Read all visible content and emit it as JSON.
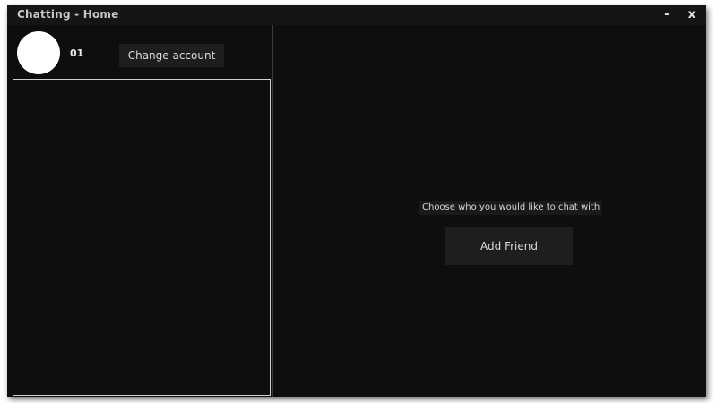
{
  "window": {
    "title": "Chatting - Home",
    "minimize_label": "-",
    "close_label": "x"
  },
  "sidebar": {
    "username": "01",
    "change_account_label": "Change account",
    "friends": []
  },
  "main": {
    "prompt": "Choose who you would like to chat with",
    "add_friend_label": "Add Friend"
  },
  "colors": {
    "background": "#0e0e0e",
    "titlebar": "#151515",
    "button": "#1e1e1e",
    "text": "#dcdcdc",
    "avatar": "#ffffff"
  }
}
